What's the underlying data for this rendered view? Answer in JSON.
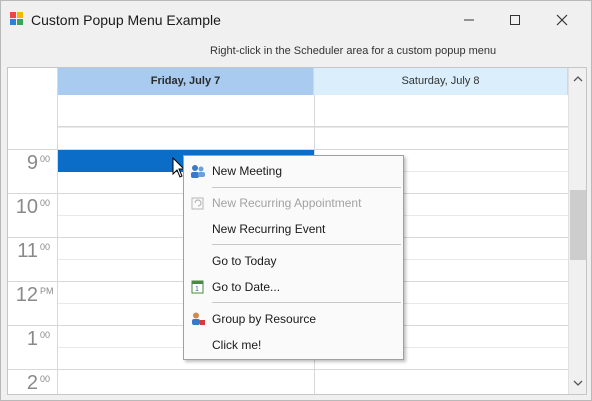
{
  "window": {
    "title": "Custom Popup Menu Example",
    "hint": "Right-click in the Scheduler area for a custom popup menu"
  },
  "scheduler": {
    "days": [
      {
        "label": "Friday, July 7",
        "selected": true
      },
      {
        "label": "Saturday, July 8",
        "selected": false
      }
    ],
    "hours": [
      {
        "h": "9",
        "m": "00"
      },
      {
        "h": "10",
        "m": "00"
      },
      {
        "h": "11",
        "m": "00"
      },
      {
        "h": "12",
        "m": "PM"
      },
      {
        "h": "1",
        "m": "00"
      },
      {
        "h": "2",
        "m": "00"
      }
    ],
    "selection_color": "#0c6dc8"
  },
  "context_menu": {
    "items": [
      {
        "label": "New Meeting",
        "icon": "meeting-icon",
        "enabled": true
      },
      {
        "label": "New Recurring Appointment",
        "icon": "recurring-appointment-icon",
        "enabled": false
      },
      {
        "label": "New Recurring Event",
        "icon": "",
        "enabled": true
      },
      {
        "label": "Go to Today",
        "icon": "",
        "enabled": true
      },
      {
        "label": "Go to Date...",
        "icon": "calendar-goto-icon",
        "enabled": true
      },
      {
        "label": "Group by Resource",
        "icon": "group-resource-icon",
        "enabled": true
      },
      {
        "label": "Click me!",
        "icon": "",
        "enabled": true
      }
    ]
  }
}
